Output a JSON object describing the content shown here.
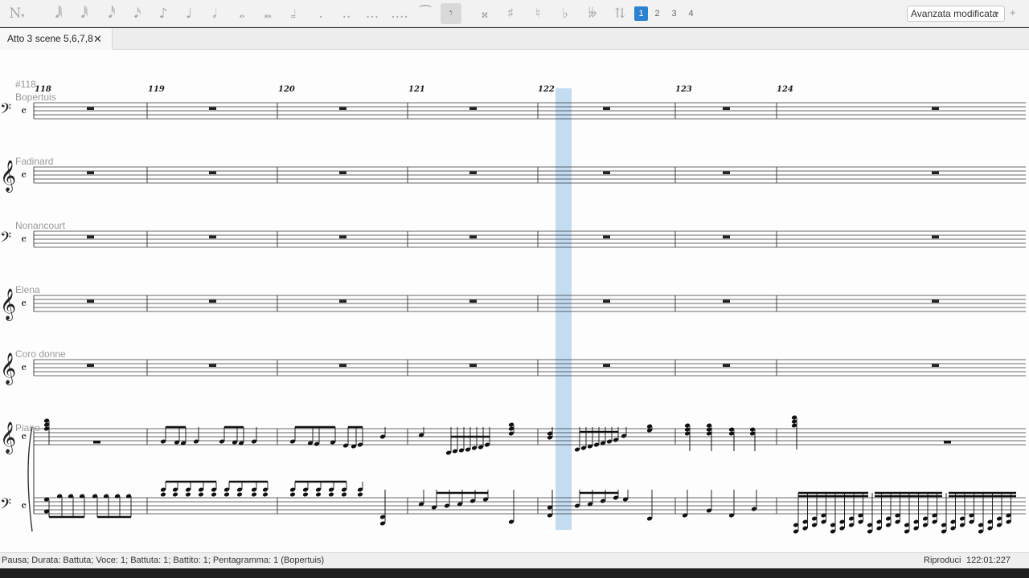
{
  "toolbar": {
    "note_input_icon": "N",
    "palette": [
      {
        "icon": "note-input-icon",
        "glyph": "𝅘𝅥𝅯"
      },
      {
        "icon": "128th-note-icon",
        "glyph": "𝅘𝅥𝅲"
      },
      {
        "icon": "64th-note-icon",
        "glyph": "𝅘𝅥𝅱"
      },
      {
        "icon": "32nd-note-icon",
        "glyph": "𝅘𝅥𝅰"
      },
      {
        "icon": "16th-note-icon",
        "glyph": "𝅘𝅥𝅯"
      },
      {
        "icon": "eighth-note-icon",
        "glyph": "♪"
      },
      {
        "icon": "quarter-note-icon",
        "glyph": "♩"
      },
      {
        "icon": "half-note-icon",
        "glyph": "𝅗𝅥"
      },
      {
        "icon": "whole-note-icon",
        "glyph": "𝅝"
      },
      {
        "icon": "breve-icon",
        "glyph": "𝅜"
      },
      {
        "icon": "longa-icon",
        "glyph": "𝆷"
      },
      {
        "icon": "dot-icon",
        "glyph": "."
      },
      {
        "icon": "double-dot-icon",
        "glyph": ".."
      },
      {
        "icon": "triple-dot-icon",
        "glyph": "..."
      },
      {
        "icon": "quadruple-dot-icon",
        "glyph": "...."
      },
      {
        "icon": "tie-icon",
        "glyph": "⁀"
      },
      {
        "icon": "rest-icon",
        "glyph": "𝄾"
      },
      {
        "icon": "double-sharp-icon",
        "glyph": "𝄪"
      },
      {
        "icon": "sharp-icon",
        "glyph": "♯"
      },
      {
        "icon": "natural-icon",
        "glyph": "♮"
      },
      {
        "icon": "flat-icon",
        "glyph": "♭"
      },
      {
        "icon": "double-flat-icon",
        "glyph": "𝄫"
      },
      {
        "icon": "flip-direction-icon",
        "glyph": "⇅"
      }
    ],
    "voices": [
      "1",
      "2",
      "3",
      "4"
    ],
    "active_voice": "1",
    "workspace": "Avanzata modificata",
    "plus": "+"
  },
  "tabs": [
    {
      "label": "Atto 3 scene 5,6,7,8",
      "close": "✕"
    }
  ],
  "score": {
    "rehearsal_mark": "#118",
    "measure_numbers": [
      "118",
      "119",
      "120",
      "121",
      "122",
      "123",
      "124"
    ],
    "staves": [
      {
        "name": "Bopertuis",
        "clef": "bass"
      },
      {
        "name": "Fadinard",
        "clef": "treble"
      },
      {
        "name": "Nonancourt",
        "clef": "bass"
      },
      {
        "name": "Elena",
        "clef": "treble"
      },
      {
        "name": "Coro donne",
        "clef": "treble"
      },
      {
        "name": "Piano",
        "clef": "treble"
      },
      {
        "name": "",
        "clef": "bass"
      }
    ],
    "time_signature": "𝄴",
    "selection_color": "#b9d6ef"
  },
  "status": {
    "selection": "Pausa; Durata: Battuta; Voce: 1;  Battuta: 1; Battito: 1; Pentagramma: 1 (Bopertuis)",
    "mode": "Riproduci",
    "time": "122:01:227"
  }
}
